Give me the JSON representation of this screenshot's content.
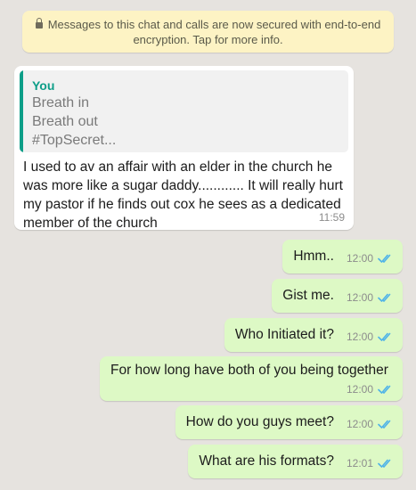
{
  "system_notice": "Messages to this chat and calls are now secured with end-to-end encryption. Tap for more info.",
  "incoming": {
    "quote": {
      "author": "You",
      "lines": [
        "Breath in",
        "Breath out",
        "#TopSecret..."
      ]
    },
    "text": "I used to av an affair with an elder in the church he was more like a sugar daddy............ It will really hurt my pastor if he finds out cox he sees as a dedicated member of the church",
    "time": "11:59"
  },
  "outgoing": [
    {
      "text": "Hmm..",
      "time": "12:00"
    },
    {
      "text": "Gist me.",
      "time": "12:00"
    },
    {
      "text": "Who Initiated it?",
      "time": "12:00"
    },
    {
      "text": "For how long have both of you being together",
      "time": "12:00"
    },
    {
      "text": "How do you guys meet?",
      "time": "12:00"
    },
    {
      "text": "What are his formats?",
      "time": "12:01"
    }
  ],
  "colors": {
    "background": "#e6e3df",
    "outgoing_bubble": "#ddf9c5",
    "incoming_bubble": "#ffffff",
    "notice_bubble": "#fdf3c4",
    "quote_accent": "#0d9e88",
    "read_ticks": "#4fb3e8"
  },
  "icons": {
    "lock": "lock-icon",
    "read_receipt": "double-check-icon"
  }
}
